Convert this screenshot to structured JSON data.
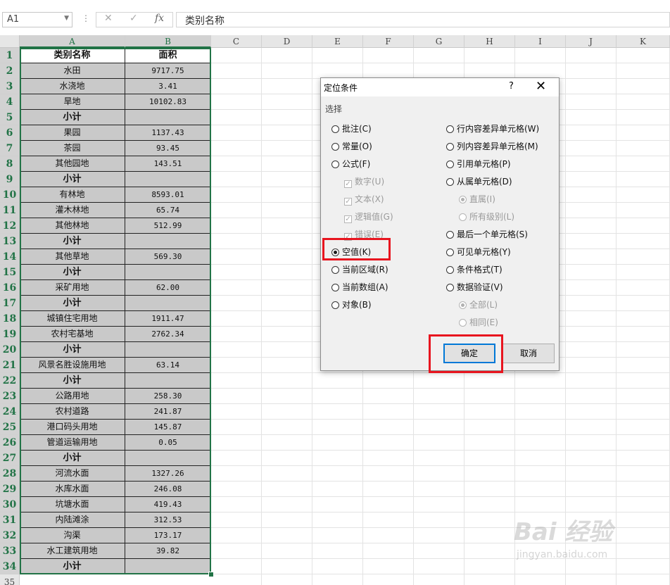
{
  "formula_bar": {
    "name_box": "A1",
    "cancel_icon": "✕",
    "enter_icon": "✓",
    "fx_icon": "fx",
    "formula": "类别名称"
  },
  "columns": [
    "A",
    "B",
    "C",
    "D",
    "E",
    "F",
    "G",
    "H",
    "I",
    "J",
    "K"
  ],
  "row_numbers": [
    "1",
    "2",
    "3",
    "4",
    "5",
    "6",
    "7",
    "8",
    "9",
    "10",
    "11",
    "12",
    "13",
    "14",
    "15",
    "16",
    "17",
    "18",
    "19",
    "20",
    "21",
    "22",
    "23",
    "24",
    "25",
    "26",
    "27",
    "28",
    "29",
    "30",
    "31",
    "32",
    "33",
    "34",
    "35"
  ],
  "table": {
    "headers": [
      "类别名称",
      "面积"
    ],
    "rows": [
      [
        "水田",
        "9717.75"
      ],
      [
        "水浇地",
        "3.41"
      ],
      [
        "旱地",
        "10102.83"
      ],
      [
        "小计",
        ""
      ],
      [
        "果园",
        "1137.43"
      ],
      [
        "茶园",
        "93.45"
      ],
      [
        "其他园地",
        "143.51"
      ],
      [
        "小计",
        ""
      ],
      [
        "有林地",
        "8593.01"
      ],
      [
        "灌木林地",
        "65.74"
      ],
      [
        "其他林地",
        "512.99"
      ],
      [
        "小计",
        ""
      ],
      [
        "其他草地",
        "569.30"
      ],
      [
        "小计",
        ""
      ],
      [
        "采矿用地",
        "62.00"
      ],
      [
        "小计",
        ""
      ],
      [
        "城镇住宅用地",
        "1911.47"
      ],
      [
        "农村宅基地",
        "2762.34"
      ],
      [
        "小计",
        ""
      ],
      [
        "风景名胜设施用地",
        "63.14"
      ],
      [
        "小计",
        ""
      ],
      [
        "公路用地",
        "258.30"
      ],
      [
        "农村道路",
        "241.87"
      ],
      [
        "港口码头用地",
        "145.87"
      ],
      [
        "管道运输用地",
        "0.05"
      ],
      [
        "小计",
        ""
      ],
      [
        "河流水面",
        "1327.26"
      ],
      [
        "水库水面",
        "246.08"
      ],
      [
        "坑塘水面",
        "419.43"
      ],
      [
        "内陆滩涂",
        "312.53"
      ],
      [
        "沟渠",
        "173.17"
      ],
      [
        "水工建筑用地",
        "39.82"
      ],
      [
        "小计",
        ""
      ]
    ]
  },
  "dialog": {
    "title": "定位条件",
    "help": "?",
    "close": "✕",
    "group_label": "选择",
    "left_options": [
      {
        "label": "批注(C)",
        "type": "radio",
        "checked": false,
        "disabled": false
      },
      {
        "label": "常量(O)",
        "type": "radio",
        "checked": false,
        "disabled": false
      },
      {
        "label": "公式(F)",
        "type": "radio",
        "checked": false,
        "disabled": false
      },
      {
        "label": "数字(U)",
        "type": "check",
        "checked": true,
        "disabled": true
      },
      {
        "label": "文本(X)",
        "type": "check",
        "checked": true,
        "disabled": true
      },
      {
        "label": "逻辑值(G)",
        "type": "check",
        "checked": true,
        "disabled": true
      },
      {
        "label": "错误(E)",
        "type": "check",
        "checked": true,
        "disabled": true
      },
      {
        "label": "空值(K)",
        "type": "radio",
        "checked": true,
        "disabled": false
      },
      {
        "label": "当前区域(R)",
        "type": "radio",
        "checked": false,
        "disabled": false
      },
      {
        "label": "当前数组(A)",
        "type": "radio",
        "checked": false,
        "disabled": false
      },
      {
        "label": "对象(B)",
        "type": "radio",
        "checked": false,
        "disabled": false
      }
    ],
    "right_options": [
      {
        "label": "行内容差异单元格(W)",
        "type": "radio",
        "checked": false,
        "disabled": false
      },
      {
        "label": "列内容差异单元格(M)",
        "type": "radio",
        "checked": false,
        "disabled": false
      },
      {
        "label": "引用单元格(P)",
        "type": "radio",
        "checked": false,
        "disabled": false
      },
      {
        "label": "从属单元格(D)",
        "type": "radio",
        "checked": false,
        "disabled": false
      },
      {
        "label": "直属(I)",
        "type": "radio",
        "checked": true,
        "disabled": true
      },
      {
        "label": "所有级别(L)",
        "type": "radio",
        "checked": false,
        "disabled": true
      },
      {
        "label": "最后一个单元格(S)",
        "type": "radio",
        "checked": false,
        "disabled": false
      },
      {
        "label": "可见单元格(Y)",
        "type": "radio",
        "checked": false,
        "disabled": false
      },
      {
        "label": "条件格式(T)",
        "type": "radio",
        "checked": false,
        "disabled": false
      },
      {
        "label": "数据验证(V)",
        "type": "radio",
        "checked": false,
        "disabled": false
      },
      {
        "label": "全部(L)",
        "type": "radio",
        "checked": true,
        "disabled": true
      },
      {
        "label": "相同(E)",
        "type": "radio",
        "checked": false,
        "disabled": true
      }
    ],
    "ok_label": "确定",
    "cancel_label": "取消"
  },
  "watermark": {
    "brand": "Bai 经验",
    "url": "jingyan.baidu.com"
  },
  "colors": {
    "selection": "#217346",
    "highlight_box": "#e8151f",
    "cell_fill": "#c9c9c9"
  }
}
